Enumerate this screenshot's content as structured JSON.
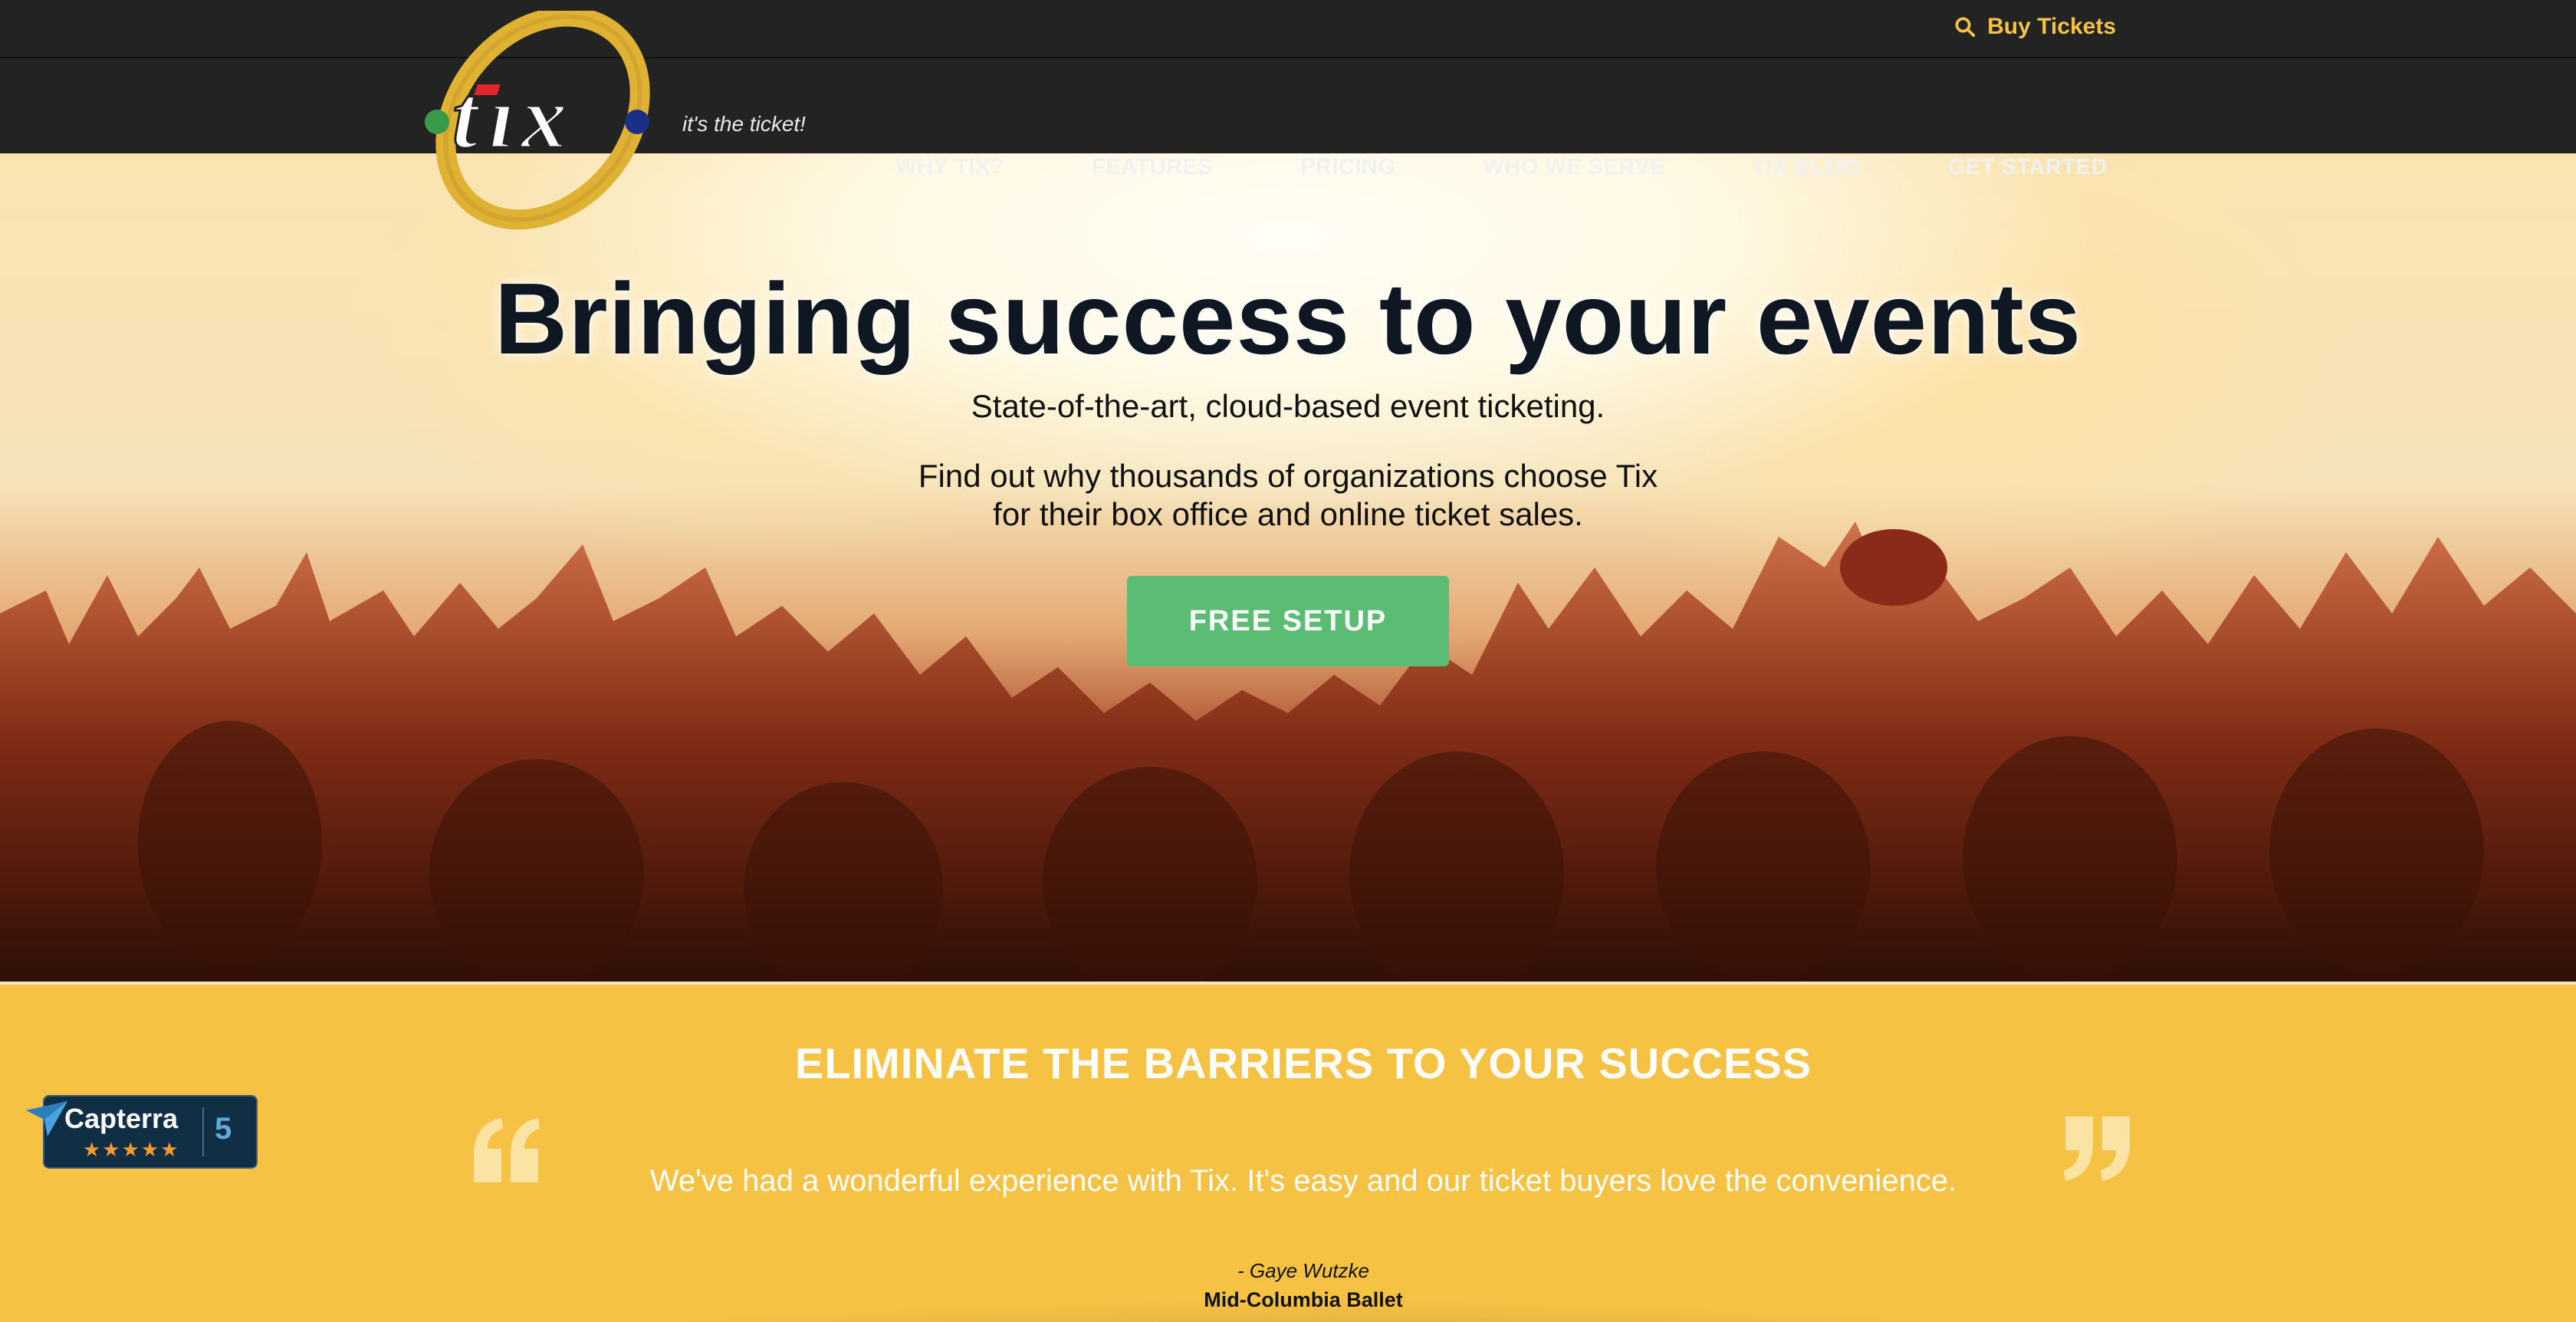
{
  "header": {
    "buy_tickets_label": "Buy Tickets",
    "logo_text": "tix",
    "tagline": "it's the ticket!",
    "nav": [
      {
        "label": "WHY TIX?"
      },
      {
        "label": "FEATURES"
      },
      {
        "label": "PRICING"
      },
      {
        "label": "WHO WE SERVE"
      },
      {
        "label": "TIX BLOG"
      },
      {
        "label": "GET STARTED"
      }
    ]
  },
  "hero": {
    "title": "Bringing success to your events",
    "subtitle": "State-of-the-art, cloud-based event ticketing.",
    "text_line1": "Find out why thousands of organizations choose Tix",
    "text_line2": "for their box office and online ticket sales.",
    "cta_label": "FREE SETUP"
  },
  "testimonial": {
    "title": "ELIMINATE THE BARRIERS TO YOUR SUCCESS",
    "quote": "We've had a wonderful experience with Tix. It's easy and our ticket buyers love the convenience.",
    "author": "- Gaye Wutzke",
    "organization": "Mid-Columbia Ballet"
  },
  "capterra": {
    "name": "Capterra",
    "stars": "★★★★★",
    "score": "5"
  },
  "colors": {
    "accent_yellow": "#f6c244",
    "cta_green": "#5bbd73",
    "dark_bar": "#232323",
    "logo_red": "#e0262c",
    "logo_green": "#3b9a4a",
    "logo_blue": "#1b2f86"
  }
}
